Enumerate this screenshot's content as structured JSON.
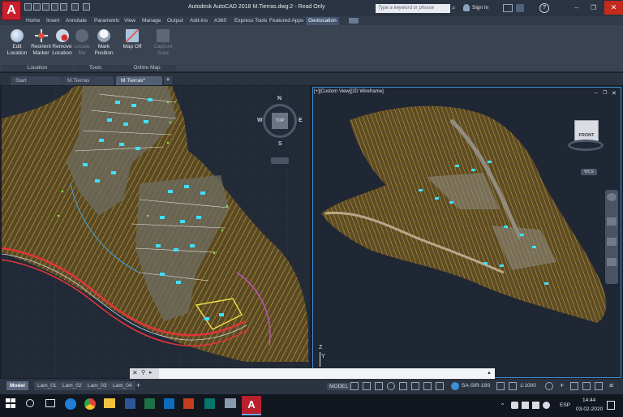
{
  "titlebar": {
    "app_logo": "A",
    "title": "Autodesk AutoCAD 2018    M.Tierras.dwg:2 - Read Only",
    "search_placeholder": "Type a keyword or phrase",
    "sign_in": "Sign In",
    "help": "?"
  },
  "ribbon_tabs": [
    "Home",
    "Insert",
    "Annotate",
    "Parametric",
    "View",
    "Manage",
    "Output",
    "Add-ins",
    "A360",
    "Express Tools",
    "Featured Apps",
    "Geolocation"
  ],
  "ribbon": {
    "buttons": [
      {
        "label1": "Edit",
        "label2": "Location",
        "icon": "globe-icon"
      },
      {
        "label1": "Reorient",
        "label2": "Marker",
        "icon": "reorient-icon"
      },
      {
        "label1": "Remove",
        "label2": "Location",
        "icon": "remove-location-icon"
      },
      {
        "label1": "Locate",
        "label2": "Me",
        "icon": "locate-me-icon"
      },
      {
        "label1": "Mark",
        "label2": "Position",
        "icon": "mark-position-icon"
      },
      {
        "label1": "Map Off",
        "label2": "",
        "icon": "map-icon"
      },
      {
        "label1": "Capture",
        "label2": "Area",
        "icon": "capture-icon"
      }
    ],
    "panels": [
      "Location",
      "Tools",
      "Online Map"
    ]
  },
  "doc_tabs": [
    "Start",
    "M.Tierras",
    "M.Tierras*"
  ],
  "viewcube": {
    "n": "N",
    "s": "S",
    "e": "E",
    "w": "W",
    "top": "TOP",
    "front": "FRONT",
    "wcs": "WCS"
  },
  "right_viewport": {
    "label": "[+][Custom View][2D Wireframe]"
  },
  "axis": {
    "x": "X",
    "y": "Y",
    "z": "Z"
  },
  "command_line": {
    "value": ""
  },
  "layout_tabs": [
    "Model",
    "Lam_01",
    "Lam_02",
    "Lam_03",
    "Lam_04"
  ],
  "status": {
    "model": "MODEL",
    "scale": "1:1000",
    "coord_system": "SA-SIR-19S"
  },
  "taskbar": {
    "lang": "ESP",
    "time": "14:44",
    "date": "03-02-2020"
  }
}
